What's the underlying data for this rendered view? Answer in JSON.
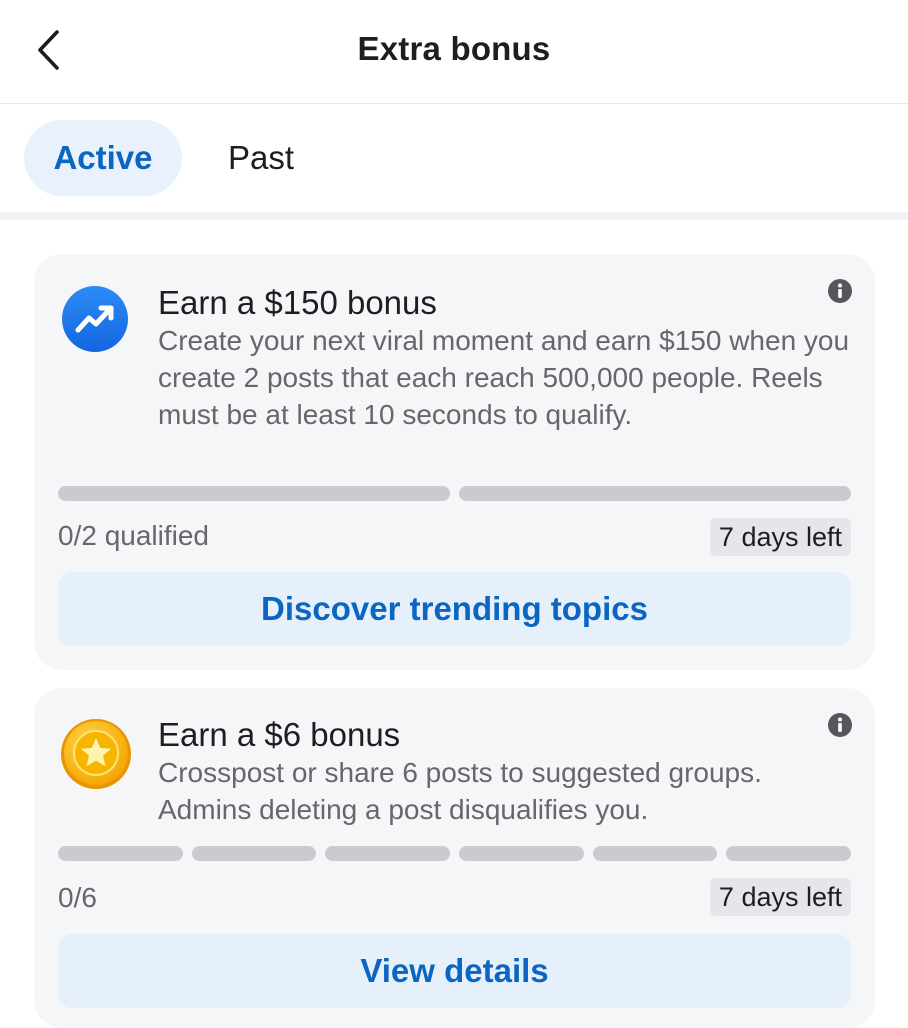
{
  "header": {
    "title": "Extra bonus",
    "back_icon": "chevron-left-icon"
  },
  "tabs": [
    {
      "label": "Active",
      "selected": true
    },
    {
      "label": "Past",
      "selected": false
    }
  ],
  "colors": {
    "accent": "#0a66c2",
    "tab_active_bg": "#e8f1fc",
    "card_bg": "#f5f6f8",
    "progress_empty": "#c9cbcf"
  },
  "bonuses": [
    {
      "icon": "trending-up-icon",
      "title": "Earn a $150 bonus",
      "description": "Create your next viral moment and earn $150 when you create 2 posts that each reach 500,000 people. Reels must be at least 10 seconds to qualify.",
      "progress": {
        "completed": 0,
        "total": 2
      },
      "status": "0/2 qualified",
      "days_left": "7 days left",
      "action_label": "Discover trending topics"
    },
    {
      "icon": "star-coin-icon",
      "title": "Earn a $6 bonus",
      "description": "Crosspost or share 6 posts to suggested groups. Admins deleting a post disqualifies you.",
      "progress": {
        "completed": 0,
        "total": 6
      },
      "status": "0/6",
      "days_left": "7 days left",
      "action_label": "View details"
    }
  ]
}
